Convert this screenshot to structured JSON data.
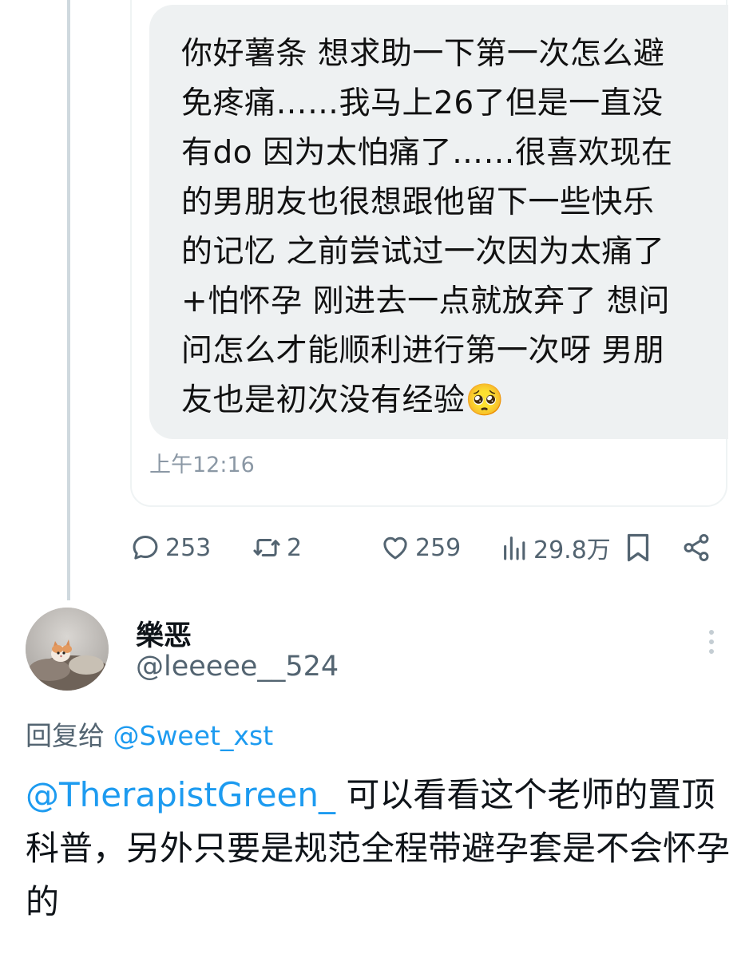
{
  "quoted_message": {
    "text": "你好薯条 想求助一下第一次怎么避\n免疼痛……我马上26了但是一直没\n有do 因为太怕痛了……很喜欢现在\n的男朋友也很想跟他留下一些快乐\n的记忆 之前尝试过一次因为太痛了\n+怕怀孕 刚进去一点就放弃了 想问\n问怎么才能顺利进行第一次呀 男朋\n友也是初次没有经验🥺",
    "time": "上午12:16"
  },
  "actions": {
    "replies": "253",
    "retweets": "2",
    "likes": "259",
    "views": "29.8万"
  },
  "reply": {
    "display_name": "樂恶",
    "handle": "@leeeee__524",
    "reply_to_label": "回复给",
    "reply_to_handle": "@Sweet_xst",
    "mention": "@TherapistGreen_",
    "text": " 可以看看这个老师的置顶科普，另外只要是规范全程带避孕套是不会怀孕的"
  },
  "colors": {
    "accent": "#1d9bf0",
    "secondary_text": "#536471",
    "bubble_bg": "#eef1f2"
  },
  "icons": [
    "reply-icon",
    "retweet-icon",
    "like-icon",
    "views-icon",
    "bookmark-icon",
    "share-icon",
    "more-icon"
  ]
}
